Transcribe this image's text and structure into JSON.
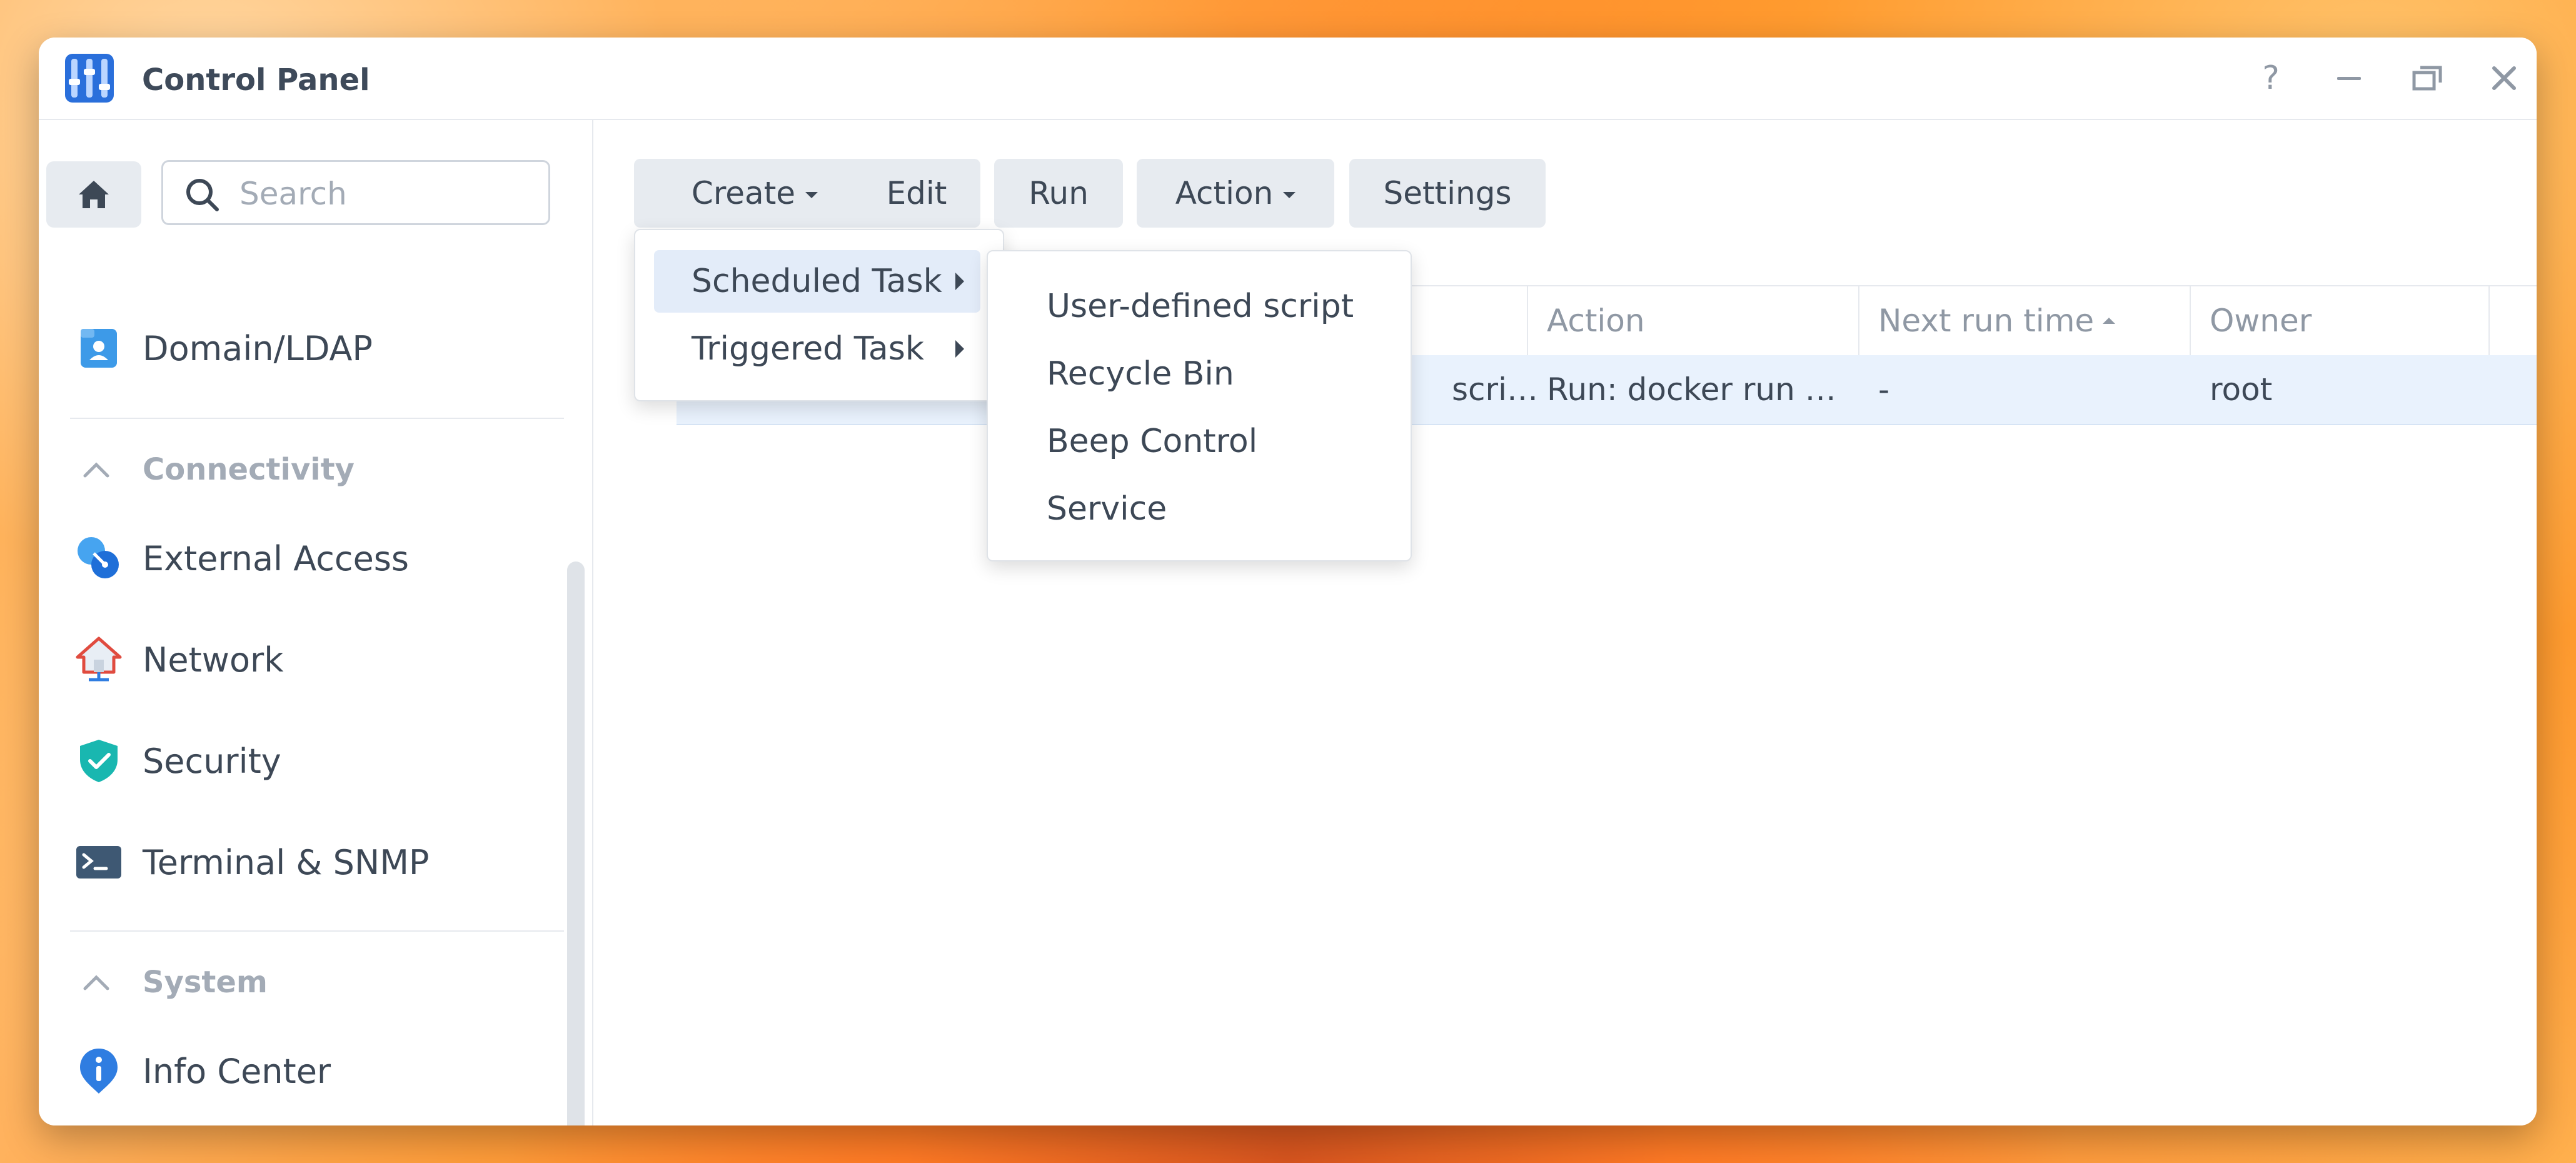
{
  "window": {
    "title": "Control Panel",
    "controls": {
      "help": "?",
      "minimize": "minimize",
      "restore": "restore",
      "close": "close"
    }
  },
  "sidebar": {
    "search_placeholder": "Search",
    "items_top": [
      {
        "label": "Domain/LDAP",
        "icon": "domain-ldap-icon"
      }
    ],
    "sections": [
      {
        "label": "Connectivity",
        "items": [
          {
            "label": "External Access",
            "icon": "external-access-icon"
          },
          {
            "label": "Network",
            "icon": "network-icon"
          },
          {
            "label": "Security",
            "icon": "security-shield-icon"
          },
          {
            "label": "Terminal & SNMP",
            "icon": "terminal-icon"
          }
        ]
      },
      {
        "label": "System",
        "items": [
          {
            "label": "Info Center",
            "icon": "info-center-icon"
          }
        ]
      }
    ]
  },
  "toolbar": {
    "create": "Create",
    "edit": "Edit",
    "run": "Run",
    "action": "Action",
    "settings": "Settings"
  },
  "table": {
    "columns": [
      "Action",
      "Next run time",
      "Owner"
    ],
    "rows": [
      {
        "type_partial": "scri…",
        "action": "Run: docker run …",
        "next_run": "-",
        "owner": "root"
      }
    ]
  },
  "create_menu": {
    "items": [
      "Scheduled Task",
      "Triggered Task"
    ]
  },
  "submenu": {
    "items": [
      "User-defined script",
      "Recycle Bin",
      "Beep Control",
      "Service"
    ]
  },
  "colors": {
    "accent": "#2f7de1",
    "row_selected": "#e9f2fd",
    "menu_active": "#e3ecf9"
  }
}
